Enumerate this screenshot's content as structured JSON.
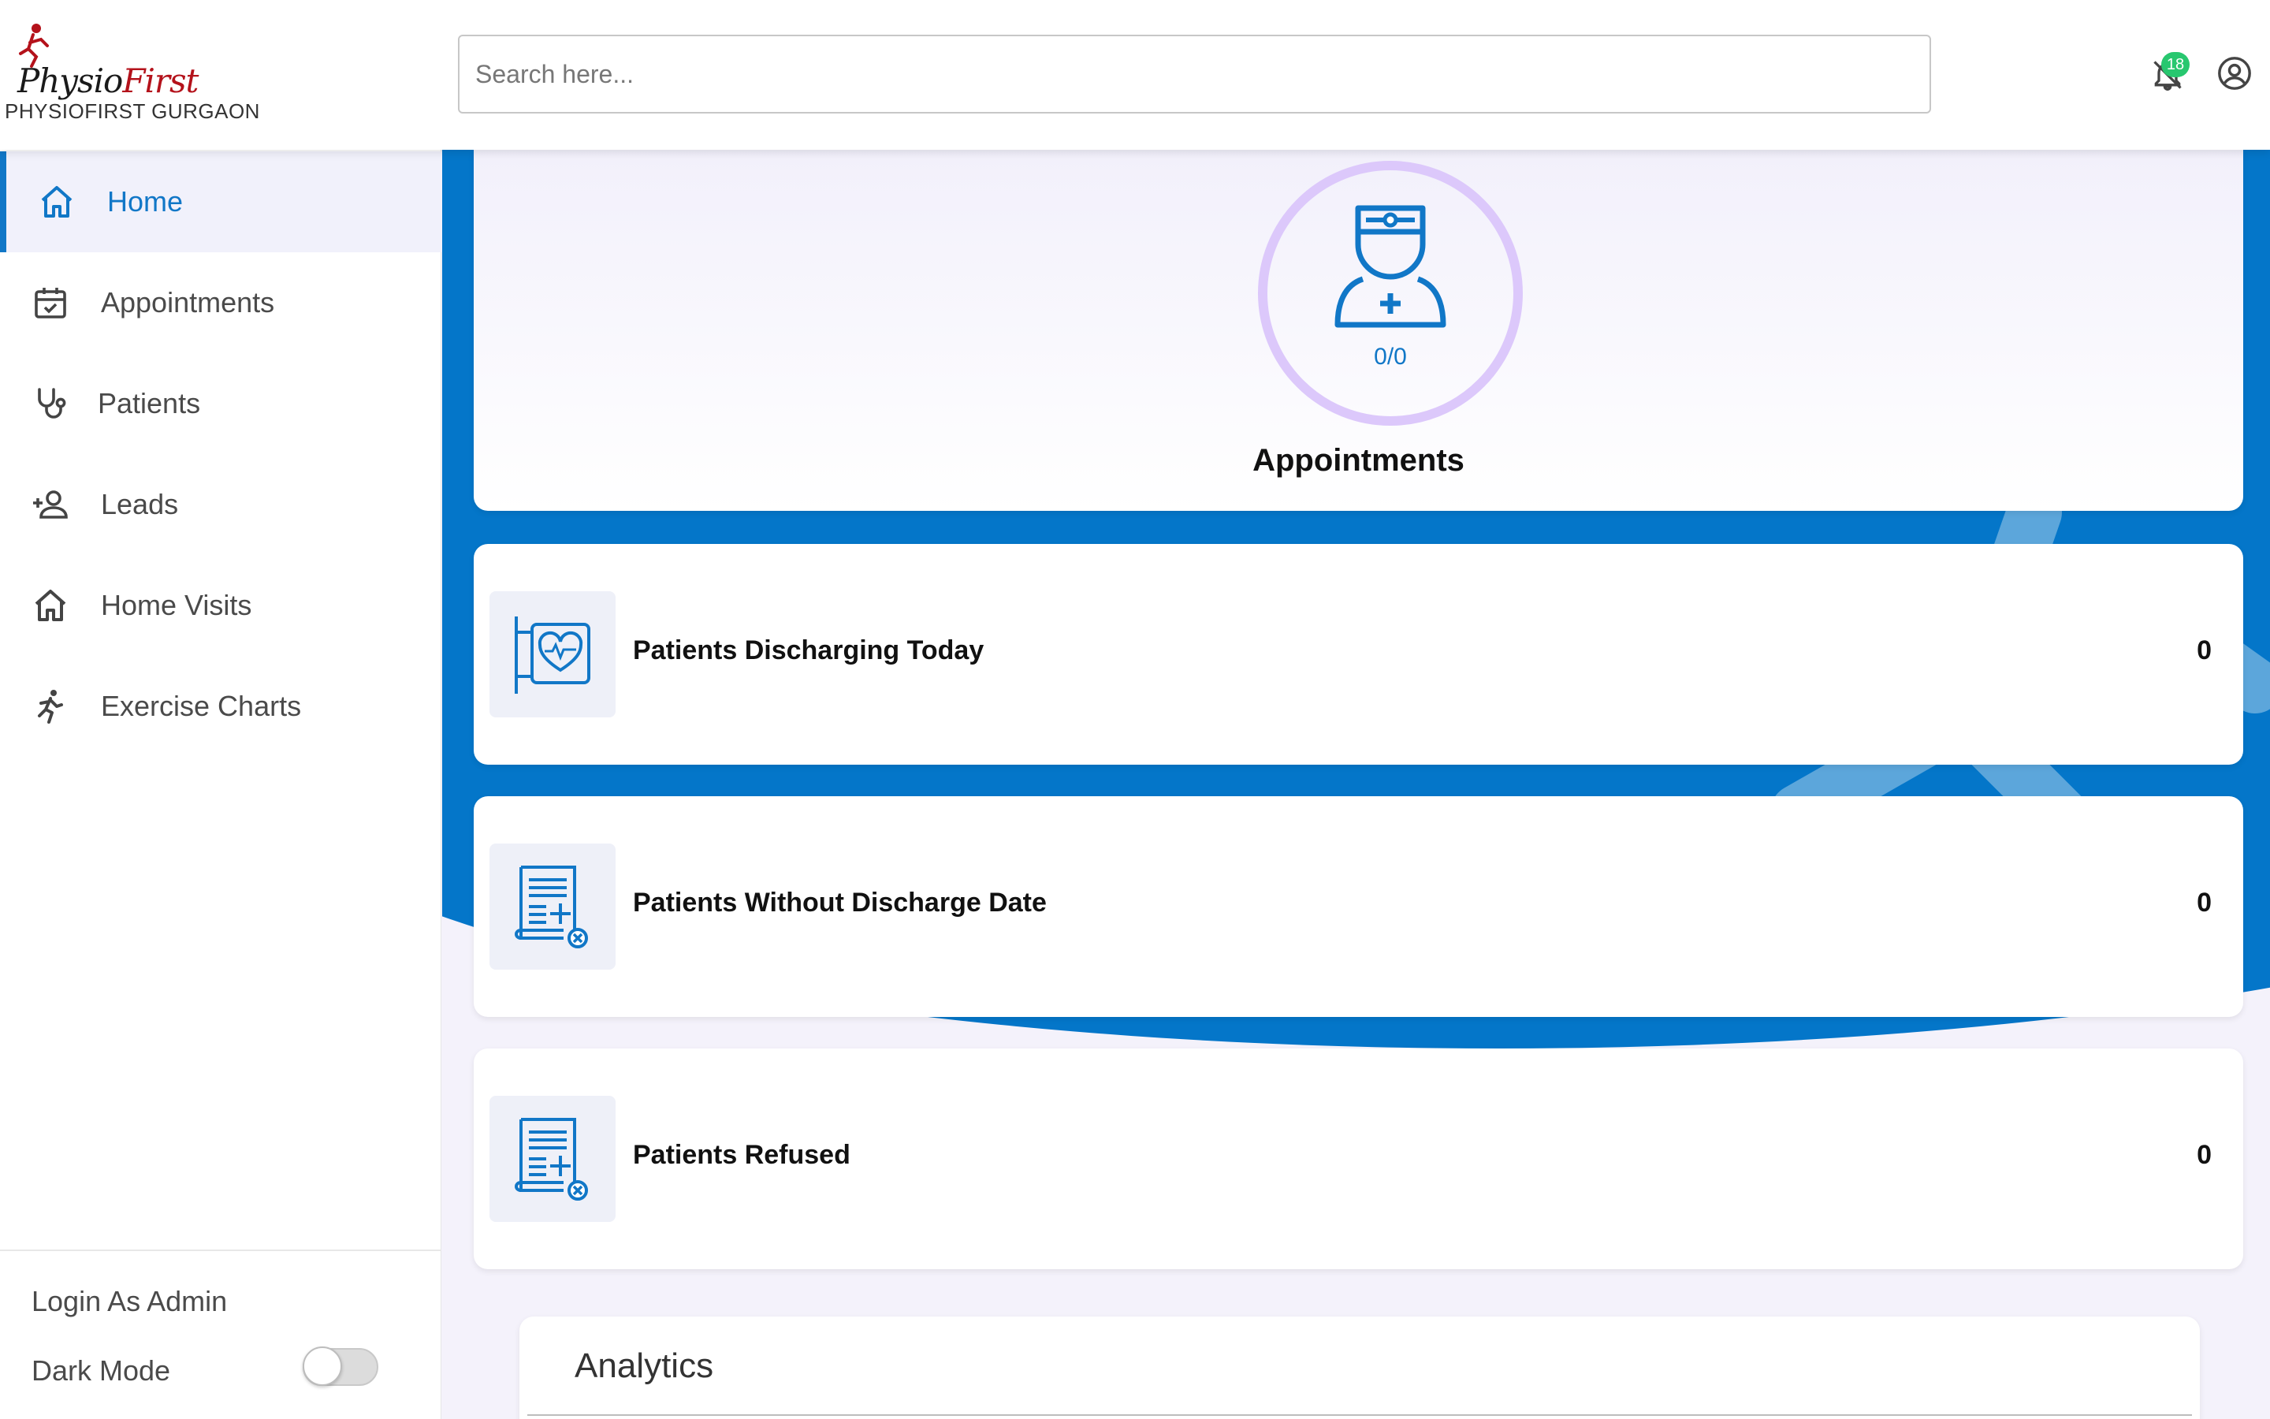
{
  "brand": {
    "logo_part1": "Physio",
    "logo_part2": "First",
    "org_name": "PHYSIOFIRST GURGAON",
    "primary_color": "#0476c9",
    "accent_red": "#b4121b"
  },
  "header": {
    "search_placeholder": "Search here...",
    "notification_count": "18"
  },
  "sidebar": {
    "items": [
      {
        "label": "Home",
        "icon": "home-icon",
        "active": true
      },
      {
        "label": "Appointments",
        "icon": "calendar-check-icon"
      },
      {
        "label": "Patients",
        "icon": "stethoscope-icon"
      },
      {
        "label": "Leads",
        "icon": "add-user-icon"
      },
      {
        "label": "Home Visits",
        "icon": "home-icon"
      },
      {
        "label": "Exercise Charts",
        "icon": "running-person-icon"
      }
    ],
    "login_admin": "Login As Admin",
    "dark_mode": "Dark Mode"
  },
  "main": {
    "appointments": {
      "count": "0/0",
      "title": "Appointments"
    },
    "stats": [
      {
        "label": "Patients Discharging Today",
        "value": "0",
        "icon": "heart-monitor-icon"
      },
      {
        "label": "Patients Without Discharge Date",
        "value": "0",
        "icon": "document-cancel-icon"
      },
      {
        "label": "Patients Refused",
        "value": "0",
        "icon": "document-cancel-icon"
      }
    ],
    "analytics_title": "Analytics"
  }
}
